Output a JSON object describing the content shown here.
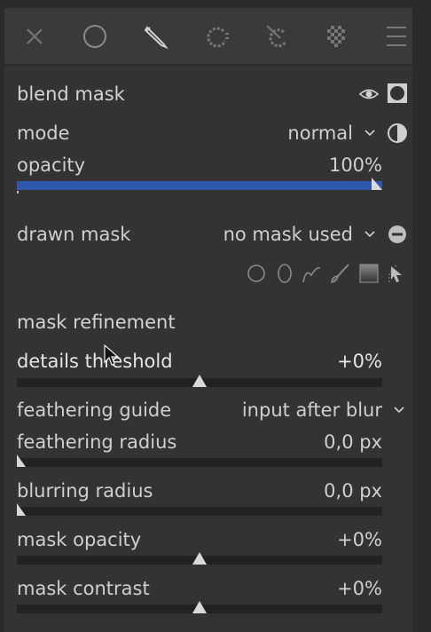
{
  "toolbar": {
    "icons": [
      "close-icon",
      "circle-icon",
      "pencil-icon",
      "parametric-icon",
      "drawn-parametric-icon",
      "raster-icon",
      "menu-icon"
    ]
  },
  "blend_mask": {
    "title": "blend mask",
    "mode_label": "mode",
    "mode_value": "normal",
    "opacity_label": "opacity",
    "opacity_value": "100%",
    "opacity_level": 1.0
  },
  "drawn_mask": {
    "label": "drawn mask",
    "value": "no mask used"
  },
  "refinement": {
    "title": "mask refinement",
    "details_label": "details threshold",
    "details_value": "+0%",
    "details_level": 0.5,
    "guide_label": "feathering guide",
    "guide_value": "input after blur",
    "feather_label": "feathering radius",
    "feather_value": "0,0 px",
    "feather_level": 0.0,
    "blur_label": "blurring radius",
    "blur_value": "0,0 px",
    "blur_level": 0.0,
    "opacity_label": "mask opacity",
    "opacity_value": "+0%",
    "opacity_level": 0.5,
    "contrast_label": "mask contrast",
    "contrast_value": "+0%",
    "contrast_level": 0.5
  },
  "colors": {
    "accent": "#2f58ad",
    "panel": "#333333",
    "text": "#cfcfcf"
  }
}
